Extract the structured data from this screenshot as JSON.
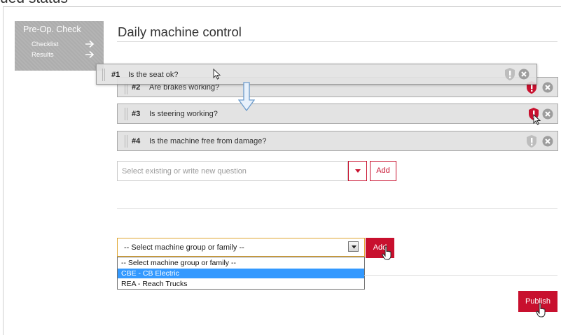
{
  "page": {
    "top_clipped_heading": "ued status",
    "title": "Daily machine control"
  },
  "sidebar": {
    "title": "Pre-Op. Check",
    "items": [
      {
        "label": "Checklist",
        "icon": "arrow-right-icon"
      },
      {
        "label": "Results",
        "icon": "arrow-right-icon"
      }
    ]
  },
  "dragged_question": {
    "number": "#1",
    "text": "Is the seat ok?",
    "critical": false
  },
  "questions": [
    {
      "number": "#2",
      "text": "Are brakes working?",
      "critical": true
    },
    {
      "number": "#3",
      "text": "Is steering working?",
      "critical": true
    },
    {
      "number": "#4",
      "text": "Is the machine free from damage?",
      "critical": false
    }
  ],
  "question_input": {
    "placeholder": "Select existing or write new question",
    "add_label": "Add"
  },
  "machine_group": {
    "selected": "-- Select machine group or family --",
    "add_label": "Add",
    "options": [
      {
        "label": "-- Select machine group or family --",
        "highlighted": false
      },
      {
        "label": "CBE - CB Electric",
        "highlighted": true
      },
      {
        "label": "REA - Reach Trucks",
        "highlighted": false
      }
    ]
  },
  "publish_label": "Publish",
  "colors": {
    "brand_red": "#c8102e",
    "sidebar_grey": "#b0b0b0",
    "row_grey": "#e3e3e3",
    "highlight_blue": "#3399ff"
  }
}
